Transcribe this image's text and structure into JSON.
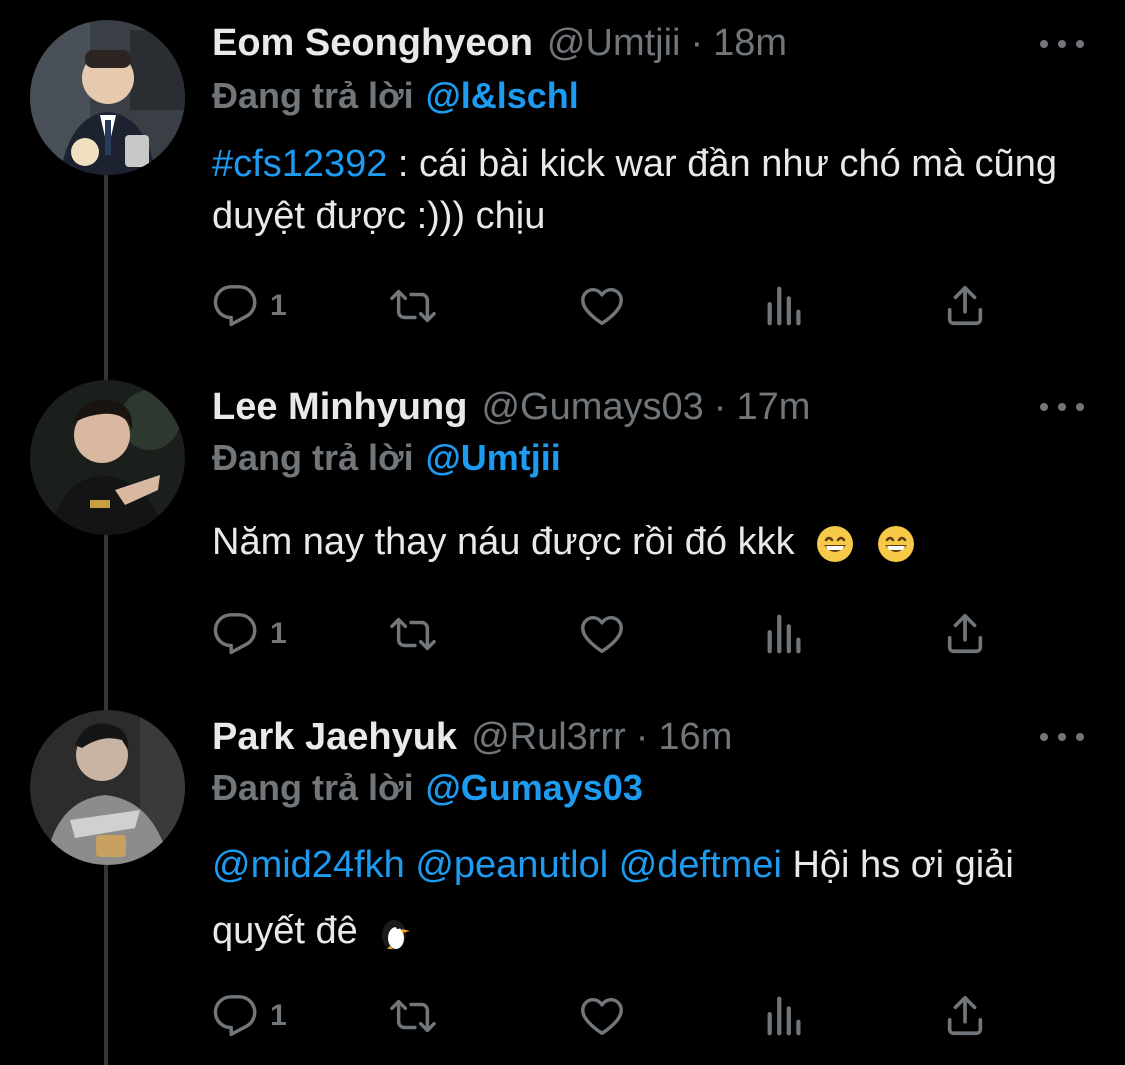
{
  "tweets": [
    {
      "name": "Eom Seonghyeon",
      "handle": "@Umtjii",
      "sep": "·",
      "time": "18m",
      "reply_prefix": "Đang trả lời",
      "reply_to": "@l&lschl",
      "body": {
        "hashtag": "#cfs12392",
        "text": " : cái bài kick war đần như chó mà cũng duyệt được :))) chịu"
      },
      "reply_count": "1",
      "avatar_icon": "person-suit-photo"
    },
    {
      "name": "Lee Minhyung",
      "handle": "@Gumays03",
      "sep": "·",
      "time": "17m",
      "reply_prefix": "Đang trả lời",
      "reply_to": "@Umtjii",
      "body": {
        "text": "Năm nay thay náu được rồi đó kkk",
        "emojis": [
          "grinning-face-emoji",
          "grinning-face-emoji"
        ]
      },
      "reply_count": "1",
      "avatar_icon": "person-dark-photo"
    },
    {
      "name": "Park Jaehyuk",
      "handle": "@Rul3rrr",
      "sep": "·",
      "time": "16m",
      "reply_prefix": "Đang trả lời",
      "reply_to": "@Gumays03",
      "body": {
        "mentions": [
          "@mid24fkh",
          "@peanutlol",
          "@deftmei"
        ],
        "text": "Hội hs ơi giải quyết đê",
        "emojis": [
          "penguin-emoji"
        ]
      },
      "reply_count": "1",
      "avatar_icon": "person-jersey-photo"
    }
  ],
  "colors": {
    "background": "#000000",
    "text": "#e7e9ea",
    "muted": "#71767b",
    "accent": "#1d9bf0",
    "thread_line": "#333639"
  },
  "action_icons": [
    "reply-icon",
    "retweet-icon",
    "like-icon",
    "views-icon",
    "share-icon"
  ]
}
